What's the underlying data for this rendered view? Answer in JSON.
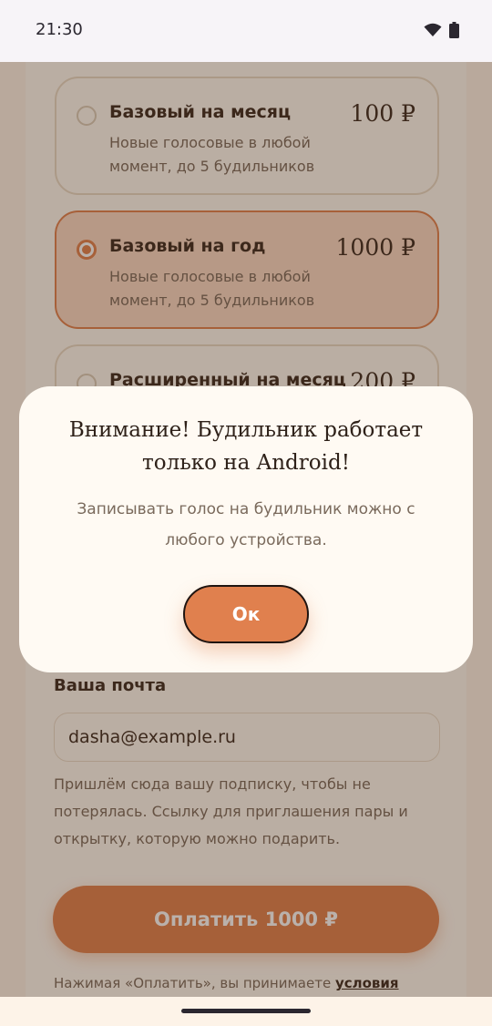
{
  "status_bar": {
    "time": "21:30",
    "icons": [
      "wifi-icon",
      "battery-icon"
    ]
  },
  "plans": [
    {
      "name": "Базовый на месяц",
      "price": "100 ₽",
      "description": "Новые голосовые в любой момент, до 5 будильников",
      "selected": false
    },
    {
      "name": "Базовый на год",
      "price": "1000 ₽",
      "description": "Новые голосовые в любой момент, до 5 будильников",
      "selected": true
    },
    {
      "name": "Расширенный на месяц",
      "price": "200 ₽",
      "description": "",
      "selected": false
    }
  ],
  "email": {
    "label": "Ваша почта",
    "value": "dasha@example.ru",
    "hint": "Пришлём сюда вашу подписку, чтобы не потерялась. Ссылку для приглашения пары и открытку, которую можно подарить."
  },
  "pay_button": {
    "label": "Оплатить 1000 ₽"
  },
  "terms": {
    "text": "Нажимая «Оплатить», вы принимаете ",
    "link": "условия"
  },
  "dialog": {
    "title": "Внимание! Будильник работает только на Android!",
    "text": "Записывать голос на будильник можно с любого устройства.",
    "ok_label": "Ок"
  },
  "colors": {
    "accent": "#e0804e",
    "background": "#fdf3e8",
    "card": "#fffaf3",
    "text_dark": "#3a2a1f",
    "text_muted": "#7a6a5c"
  }
}
